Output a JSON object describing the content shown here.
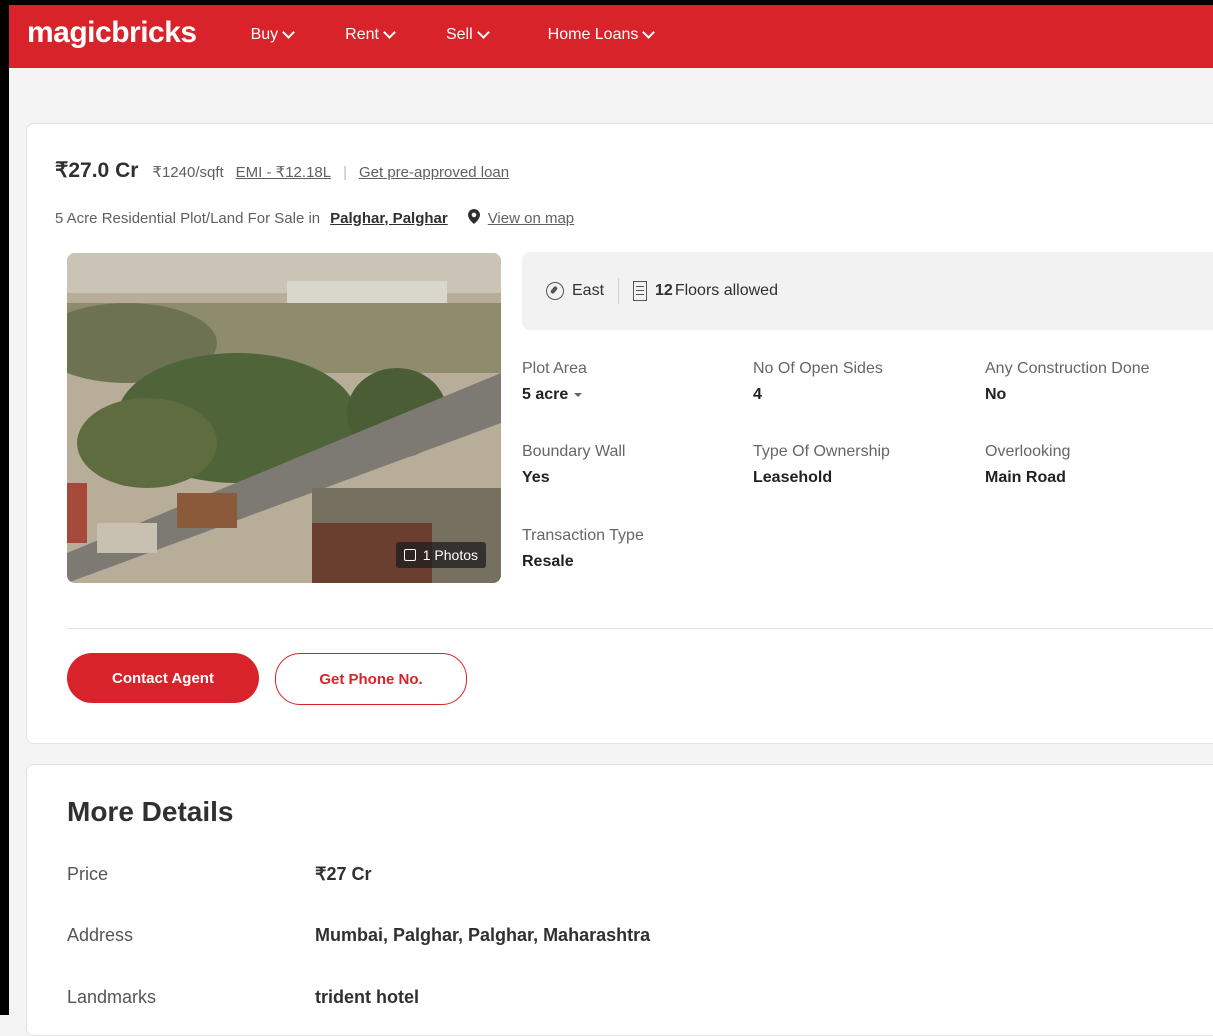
{
  "nav": {
    "logo": "magicbricks",
    "items": [
      {
        "label": "Buy"
      },
      {
        "label": "Rent"
      },
      {
        "label": "Sell"
      },
      {
        "label": "Home Loans"
      }
    ]
  },
  "listing": {
    "price": "₹27.0 Cr",
    "price_per_sqft": "₹1240/sqft",
    "emi": "EMI - ₹12.18L",
    "loan_link": "Get pre-approved loan",
    "subtitle_prefix": "5 Acre Residential Plot/Land For Sale in",
    "location": "Palghar, Palghar",
    "map_link": "View on map",
    "photo_count": "1 Photos",
    "facing": "East",
    "floors_num": "12",
    "floors_label": "Floors allowed",
    "attributes": [
      {
        "label": "Plot Area",
        "value": "5 acre"
      },
      {
        "label": "No Of Open Sides",
        "value": "4"
      },
      {
        "label": "Any Construction Done",
        "value": "No"
      },
      {
        "label": "Boundary Wall",
        "value": "Yes"
      },
      {
        "label": "Type Of Ownership",
        "value": "Leasehold"
      },
      {
        "label": "Overlooking",
        "value": "Main Road"
      },
      {
        "label": "Transaction Type",
        "value": "Resale"
      }
    ],
    "buttons": {
      "contact": "Contact Agent",
      "phone": "Get Phone No."
    }
  },
  "more_details": {
    "title": "More Details",
    "rows": [
      {
        "key": "Price",
        "value": "₹27 Cr"
      },
      {
        "key": "Address",
        "value": "Mumbai, Palghar, Palghar, Maharashtra"
      },
      {
        "key": "Landmarks",
        "value": "trident hotel"
      }
    ]
  },
  "colors": {
    "brand": "#d8232a"
  }
}
